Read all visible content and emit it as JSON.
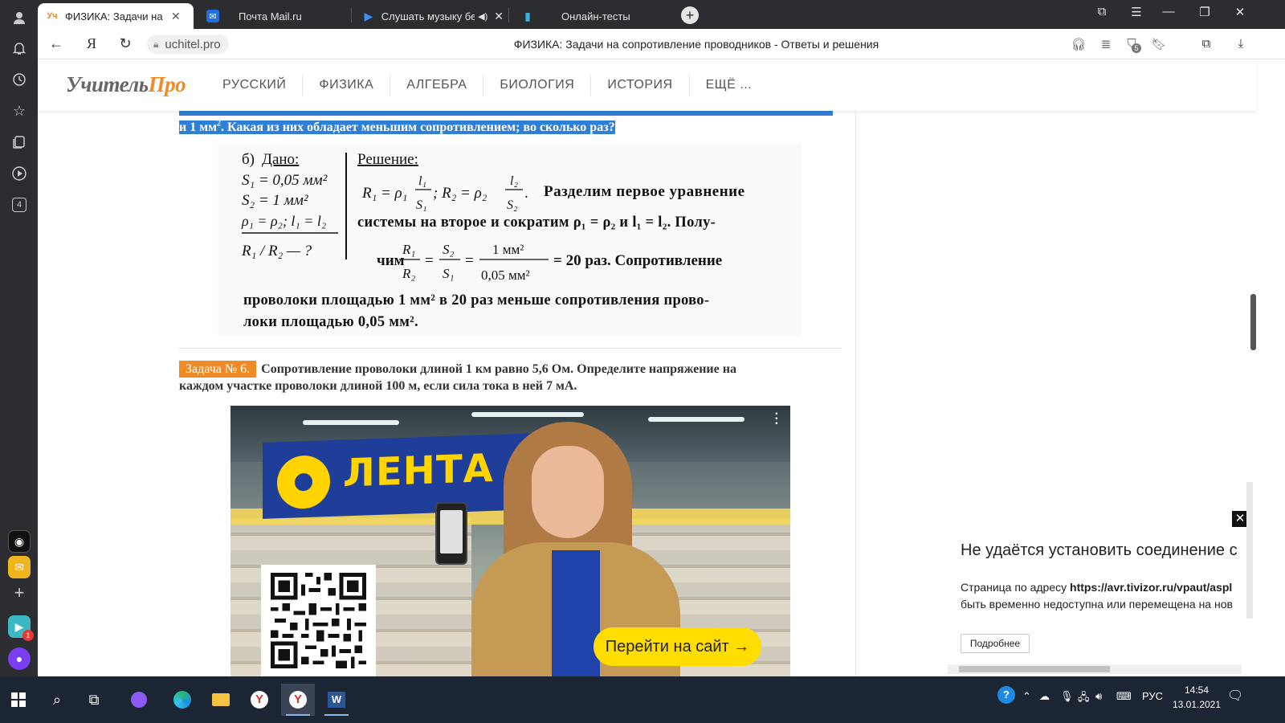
{
  "browser": {
    "tabs": [
      {
        "title": "ФИЗИКА: Задачи на сопр",
        "favicon": "Уч",
        "active": true
      },
      {
        "title": "Почта Mail.ru",
        "favicon": "mail-icon"
      },
      {
        "title": "Слушать музыку бес",
        "favicon": "play-icon"
      },
      {
        "title": "Онлайн-тесты",
        "favicon": "test-icon"
      }
    ],
    "address": "uchitel.pro",
    "page_title": "ФИЗИКА: Задачи на сопротивление проводников - Ответы и решения",
    "rail_badge": "4",
    "rail_mail_badge": "1",
    "tray_badge": "5"
  },
  "site": {
    "logo_main": "Учитель",
    "logo_accent": "Про",
    "menu": [
      "РУССКИЙ",
      "ФИЗИКА",
      "АЛГЕБРА",
      "БИОЛОГИЯ",
      "ИСТОРИЯ",
      "ЕЩЁ ..."
    ]
  },
  "problem5": {
    "text_tail_before_sup": "и 1 мм",
    "sup": "2",
    "text_tail_after_sup": ". Какая из них обладает меньшим сопротивлением; во сколько раз?"
  },
  "solution": {
    "label": "б)",
    "given_title": "Дано:",
    "given": [
      "S₁ = 0,05 мм²",
      "S₂ = 1 мм²",
      "ρ₁ = ρ₂; l₁ = l₂"
    ],
    "find": "R₁ / R₂ — ?",
    "solution_title": "Решение:",
    "line1_text": "Разделим первое уравнение",
    "line2": "системы на второе и сократим ρ₁ = ρ₂ и l₁ = l₂. Полу-",
    "line3_prefix": "чим",
    "line3_result": "= 20 раз. Сопротивление",
    "line4": "проволоки площадью 1 мм² в 20 раз меньше сопротивления прово-",
    "line5": "локи площадью 0,05 мм²."
  },
  "problem6": {
    "badge": "Задача № 6.",
    "text_line1": "Сопротивление проволоки длиной 1 км равно 5,6 Ом. Определите напряжение на",
    "text_line2": "каждом участке проволоки длиной 100 м, если сила тока в ней 7 мА."
  },
  "ad": {
    "brand": "ЛЕНТА",
    "cta": "Перейти на сайт →"
  },
  "popup": {
    "close": "✕",
    "title": "Не удаётся установить соединение с",
    "body_prefix": "Страница по адресу ",
    "body_url": "https://avr.tivizor.ru/vpaut/aspl",
    "body_line2": "быть временно недоступна или перемещена на нов",
    "more_button": "Подробнее"
  },
  "taskbar": {
    "lang": "РУС",
    "time": "14:54",
    "date": "13.01.2021"
  },
  "colors": {
    "accent_orange": "#f08a24",
    "highlight_blue": "#2f7fd6",
    "tab_bar": "#2b2d31",
    "taskbar": "#1c2533",
    "ad_cta": "#ffdd00"
  }
}
